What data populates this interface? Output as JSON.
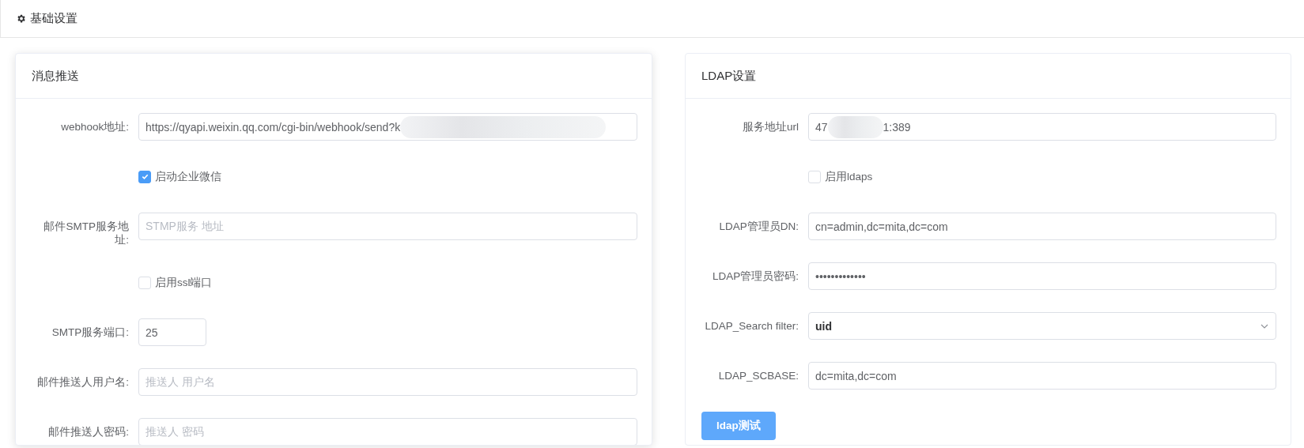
{
  "header": {
    "title": "基础设置"
  },
  "panels": [
    {
      "title": "消息推送",
      "raised": true,
      "rows": [
        {
          "kind": "text",
          "label": "webhook地址:",
          "value": "https://qyapi.weixin.qq.com/cgi-bin/webhook/send?k",
          "redacted": true
        },
        {
          "kind": "checkbox",
          "label": "启动企业微信",
          "checked": true
        },
        {
          "kind": "text",
          "label": "邮件SMTP服务地址:",
          "placeholder": "STMP服务 地址"
        },
        {
          "kind": "checkbox",
          "label": "启用ssl端口",
          "checked": false
        },
        {
          "kind": "number",
          "label": "SMTP服务端口:",
          "value": "25"
        },
        {
          "kind": "text",
          "label": "邮件推送人用户名:",
          "placeholder": "推送人 用户名"
        },
        {
          "kind": "text",
          "label": "邮件推送人密码:",
          "placeholder": "推送人 密码"
        }
      ]
    },
    {
      "title": "LDAP设置",
      "raised": false,
      "rows": [
        {
          "kind": "text",
          "label": "服务地址url",
          "value": "47",
          "redacted": true,
          "value_after": "1:389"
        },
        {
          "kind": "checkbox",
          "label": "启用ldaps",
          "checked": false
        },
        {
          "kind": "text",
          "label": "LDAP管理员DN:",
          "value": "cn=admin,dc=mita,dc=com"
        },
        {
          "kind": "text",
          "label": "LDAP管理员密码:",
          "value": "•••••••••••••"
        },
        {
          "kind": "select",
          "label": "LDAP_Search filter:",
          "value": "uid"
        },
        {
          "kind": "text",
          "label": "LDAP_SCBASE:",
          "value": "dc=mita,dc=com"
        },
        {
          "kind": "button",
          "label": "ldap测试"
        }
      ]
    }
  ]
}
